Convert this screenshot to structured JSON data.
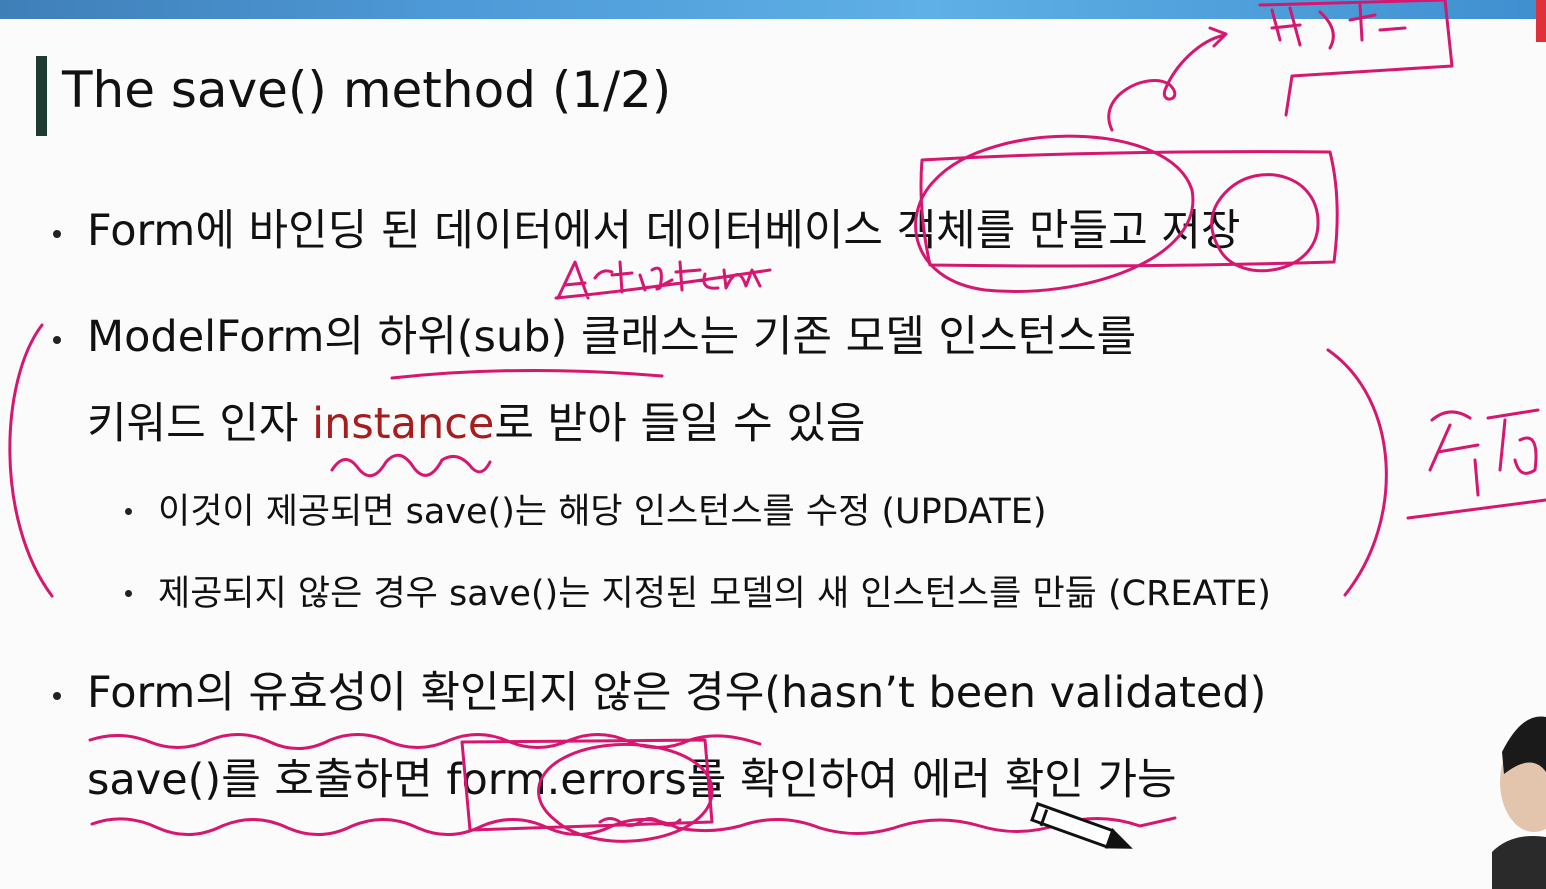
{
  "slide": {
    "title": "The save() method (1/2)",
    "bullets": {
      "b1": "Form에 바인딩 된 데이터에서 데이터베이스 객체를 만들고 저장",
      "b2_part1": "ModelForm의 하위(sub) 클래스는 기존 모델 인스턴스를",
      "b2_part2_pre": "키워드 인자 ",
      "b2_part2_kw": "instance",
      "b2_part2_post": "로 받아 들일 수 있음",
      "b2_sub1": "이것이 제공되면 save()는 해당 인스턴스를 수정 (UPDATE)",
      "b2_sub2": "제공되지 않은 경우 save()는 지정된 모델의 새 인스턴스를 만듦 (CREATE)",
      "b3_part1": "Form의 유효성이 확인되지 않은 경우(hasn’t been validated)",
      "b3_part2": "save()를 호출하면 form.errors를 확인하여 에러 확인 가능"
    }
  },
  "annotations": {
    "handwriting_top_right": "변환",
    "handwriting_mid": "ArticleForm",
    "handwriting_right": "수정"
  },
  "colors": {
    "ink": "#d6166f",
    "keyword": "#a51d1d",
    "title_bar": "#1f3a30",
    "top_bar": "#4e9ad8"
  }
}
